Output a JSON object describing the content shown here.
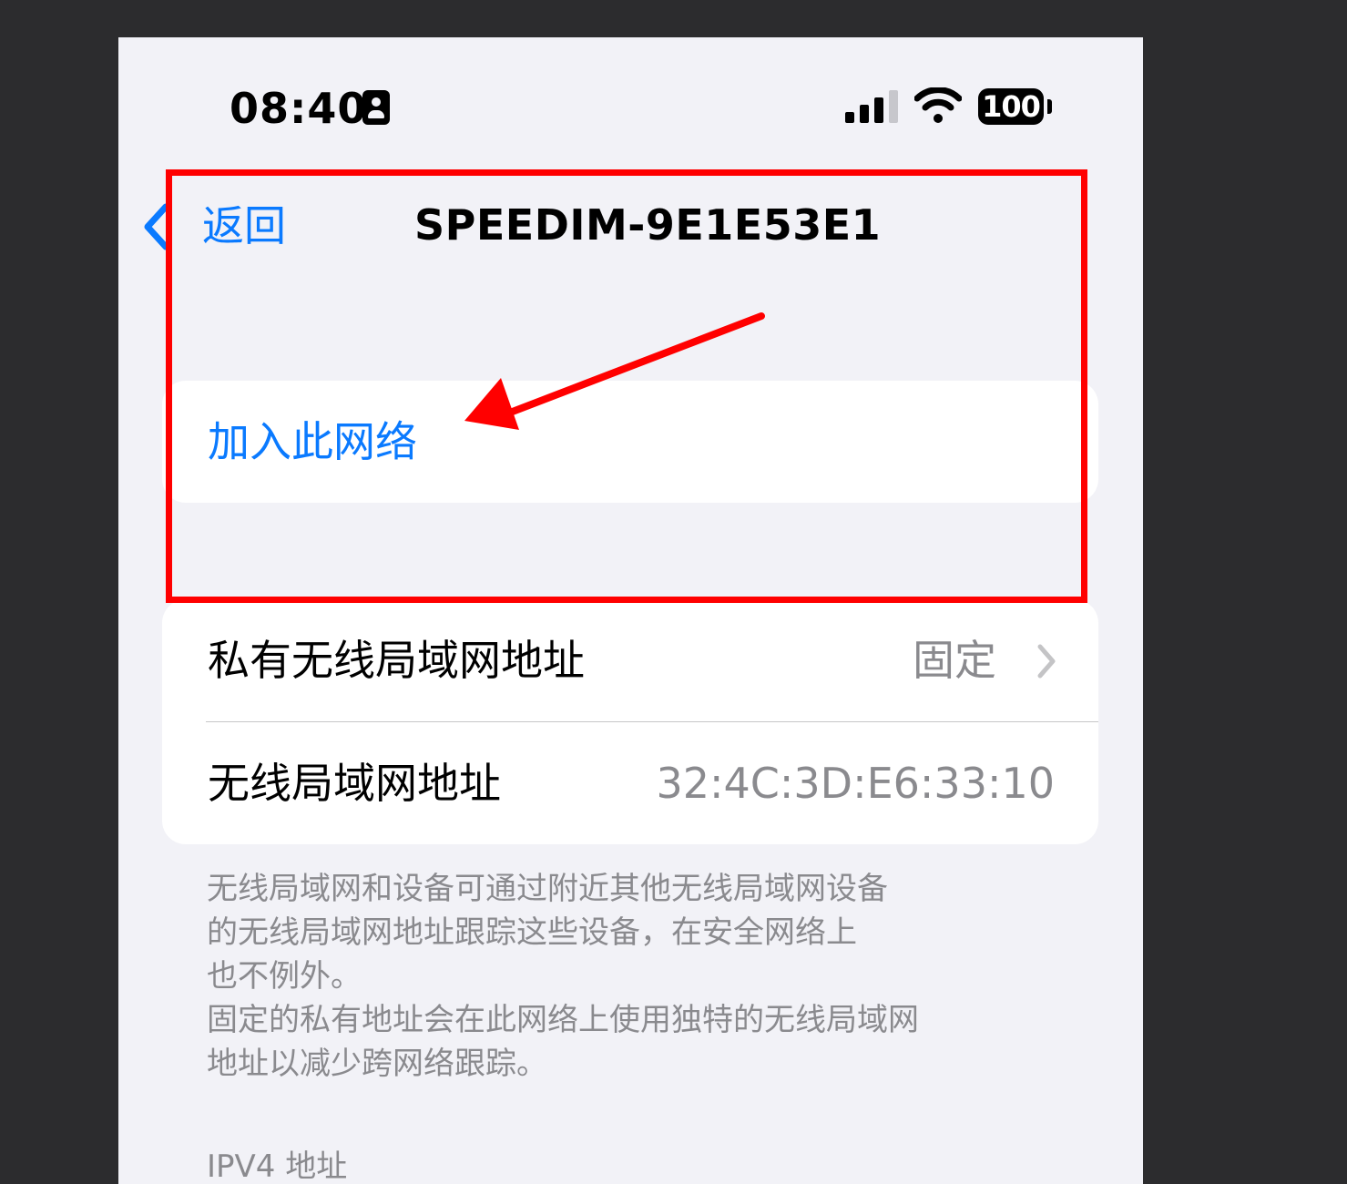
{
  "status_bar": {
    "time": "08:40",
    "battery": "100",
    "icons": [
      "id-card-icon",
      "cellular-signal-icon",
      "wifi-icon",
      "battery-icon"
    ]
  },
  "nav": {
    "back_label": "返回",
    "title": "SPEEDIM-9E1E53E1"
  },
  "join": {
    "label": "加入此网络"
  },
  "mac_section": {
    "rows": [
      {
        "label": "私有无线局域网地址",
        "value": "固定"
      },
      {
        "label": "无线局域网地址",
        "value": "32:4C:3D:E6:33:10"
      }
    ]
  },
  "footer": {
    "lines": [
      "无线局域网和设备可通过附近其他无线局域网设备",
      "的无线局域网地址跟踪这些设备，在安全网络上",
      "也不例外。",
      "固定的私有地址会在此网络上使用独特的无线局域网",
      "地址以减少跨网络跟踪。"
    ]
  },
  "ipv4": {
    "header": "IPV4 地址"
  },
  "colors": {
    "accent": "#0a7aff",
    "background": "#f2f2f7",
    "card": "#ffffff",
    "secondary_text": "#8a8a8e",
    "annotation": "#ff0000",
    "outer_frame": "#2c2c2e"
  }
}
